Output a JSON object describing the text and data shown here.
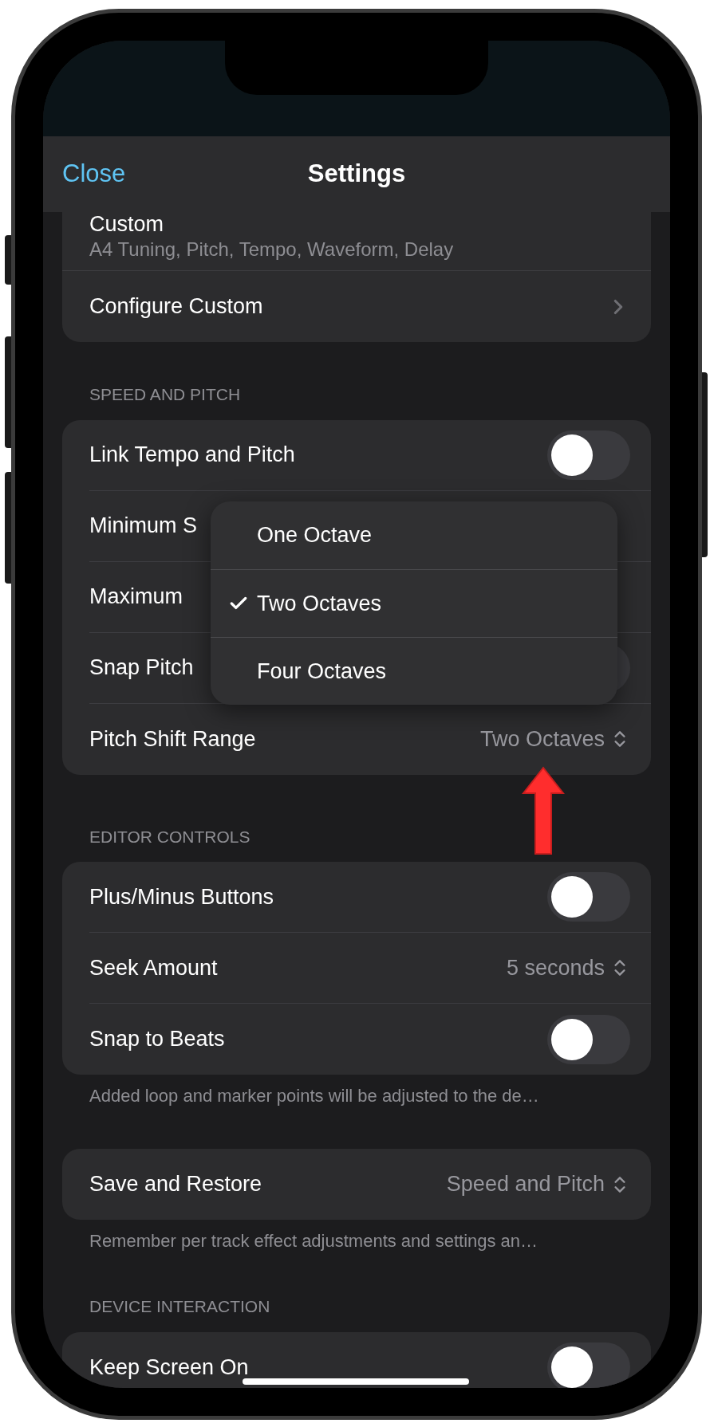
{
  "nav": {
    "close": "Close",
    "title": "Settings"
  },
  "sections": [
    {
      "rows": [
        {
          "kind": "subtitle",
          "label": "Custom",
          "detail": "A4 Tuning, Pitch, Tempo, Waveform, Delay"
        },
        {
          "kind": "link",
          "label": "Configure Custom"
        }
      ]
    },
    {
      "header": "SPEED AND PITCH",
      "rows": [
        {
          "kind": "toggle",
          "label": "Link Tempo and Pitch",
          "on": false
        },
        {
          "kind": "plain",
          "label": "Minimum S"
        },
        {
          "kind": "plain",
          "label": "Maximum"
        },
        {
          "kind": "toggle",
          "label": "Snap Pitch",
          "on": false
        },
        {
          "kind": "menu",
          "label": "Pitch Shift Range",
          "value": "Two Octaves"
        }
      ]
    },
    {
      "header": "EDITOR CONTROLS",
      "rows": [
        {
          "kind": "toggle",
          "label": "Plus/Minus Buttons",
          "on": false
        },
        {
          "kind": "menu",
          "label": "Seek Amount",
          "value": "5 seconds"
        },
        {
          "kind": "toggle",
          "label": "Snap to Beats",
          "on": false
        }
      ],
      "footer": "Added loop and marker points will be adjusted to the de…"
    },
    {
      "rows": [
        {
          "kind": "menu",
          "label": "Save and Restore",
          "value": "Speed and Pitch"
        }
      ],
      "footer": "Remember per track effect adjustments and settings an…"
    },
    {
      "header": "DEVICE INTERACTION",
      "rows": [
        {
          "kind": "toggle",
          "label": "Keep Screen On",
          "on": false
        }
      ]
    }
  ],
  "menu": {
    "options": [
      {
        "label": "One Octave",
        "selected": false
      },
      {
        "label": "Two Octaves",
        "selected": true
      },
      {
        "label": "Four Octaves",
        "selected": false
      }
    ]
  }
}
